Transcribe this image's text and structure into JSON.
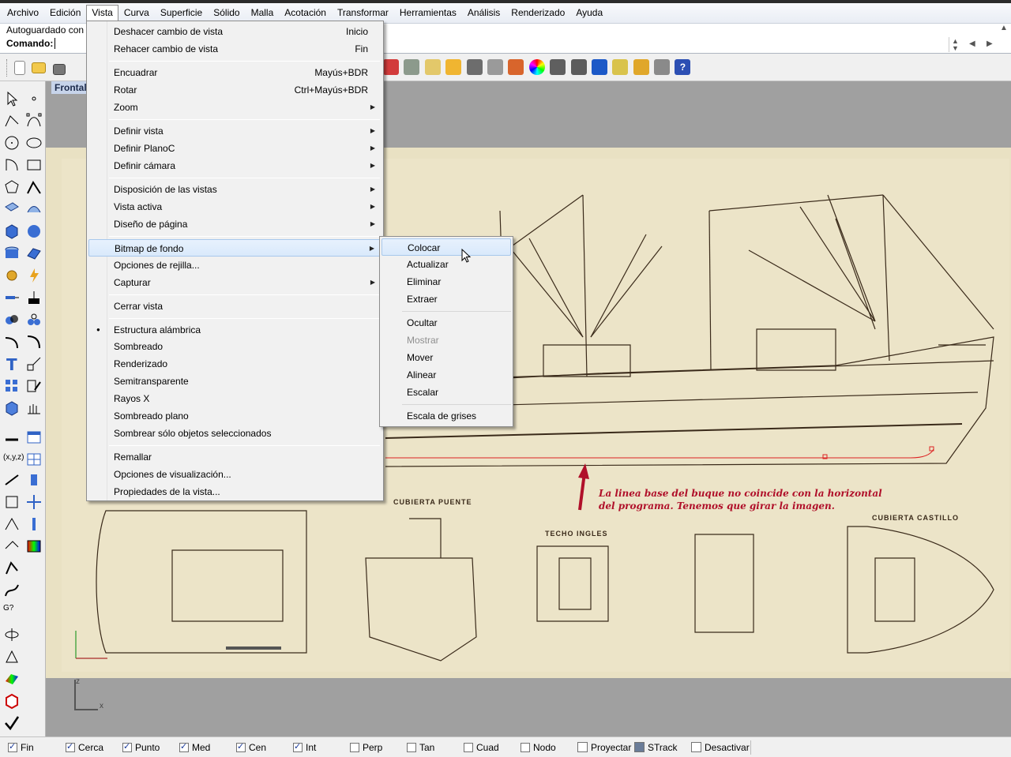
{
  "menubar": {
    "items": [
      "Archivo",
      "Edición",
      "Vista",
      "Curva",
      "Superficie",
      "Sólido",
      "Malla",
      "Acotación",
      "Transformar",
      "Herramientas",
      "Análisis",
      "Renderizado",
      "Ayuda"
    ],
    "open_index": 2
  },
  "command": {
    "history_line": "Autoguardado con",
    "prompt": "Comando:"
  },
  "viewport": {
    "title": "Frontal",
    "annotation_line1": "La linea base del  buque no coincide con la horizontal",
    "annotation_line2": "del programa. Tenemos que girar la imagen.",
    "plan_labels": [
      "CUBIERTA PUENTE",
      "TECHO INGLES",
      "CUBIERTA CASTILLO"
    ],
    "axis_z": "z",
    "axis_x": "x"
  },
  "vista_menu": {
    "items": [
      {
        "label": "Deshacer cambio de vista",
        "shortcut": "Inicio"
      },
      {
        "label": "Rehacer cambio de vista",
        "shortcut": "Fin"
      },
      {
        "label": "Encuadrar",
        "shortcut": "Mayús+BDR"
      },
      {
        "label": "Rotar",
        "shortcut": "Ctrl+Mayús+BDR"
      },
      {
        "label": "Zoom",
        "submenu": true
      },
      {
        "label": "Definir vista",
        "submenu": true
      },
      {
        "label": "Definir PlanoC",
        "submenu": true
      },
      {
        "label": "Definir cámara",
        "submenu": true
      },
      {
        "label": "Disposición de las vistas",
        "submenu": true
      },
      {
        "label": "Vista activa",
        "submenu": true
      },
      {
        "label": "Diseño de página",
        "submenu": true
      },
      {
        "label": "Bitmap de fondo",
        "submenu": true,
        "highlighted": true
      },
      {
        "label": "Opciones de rejilla..."
      },
      {
        "label": "Capturar",
        "submenu": true
      },
      {
        "label": "Cerrar vista"
      },
      {
        "label": "Estructura alámbrica",
        "checked": true
      },
      {
        "label": "Sombreado"
      },
      {
        "label": "Renderizado"
      },
      {
        "label": "Semitransparente"
      },
      {
        "label": "Rayos X"
      },
      {
        "label": "Sombreado plano"
      },
      {
        "label": "Sombrear sólo objetos seleccionados"
      },
      {
        "label": "Remallar"
      },
      {
        "label": "Opciones de visualización..."
      },
      {
        "label": "Propiedades de la vista..."
      }
    ]
  },
  "bitmap_submenu": {
    "items": [
      {
        "label": "Colocar",
        "highlighted": true
      },
      {
        "label": "Actualizar"
      },
      {
        "label": "Eliminar"
      },
      {
        "label": "Extraer"
      },
      {
        "label": "Ocultar"
      },
      {
        "label": "Mostrar",
        "disabled": true
      },
      {
        "label": "Mover"
      },
      {
        "label": "Alinear"
      },
      {
        "label": "Escalar"
      },
      {
        "label": "Escala de grises"
      }
    ]
  },
  "status": {
    "osnaps": [
      {
        "label": "Fin",
        "checked": true
      },
      {
        "label": "Cerca",
        "checked": true
      },
      {
        "label": "Punto",
        "checked": true
      },
      {
        "label": "Med",
        "checked": true
      },
      {
        "label": "Cen",
        "checked": true
      },
      {
        "label": "Int",
        "checked": true
      },
      {
        "label": "Perp",
        "checked": false
      },
      {
        "label": "Tan",
        "checked": false
      },
      {
        "label": "Cuad",
        "checked": false
      },
      {
        "label": "Nodo",
        "checked": false
      },
      {
        "label": "Proyectar",
        "checked": false
      },
      {
        "label": "STrack",
        "checked": false
      },
      {
        "label": "Desactivar",
        "checked": false
      }
    ]
  },
  "colors": {
    "paper": "#e7dfc0",
    "annotation": "#b0102a",
    "menu_highlight": "#d9e9fb"
  }
}
